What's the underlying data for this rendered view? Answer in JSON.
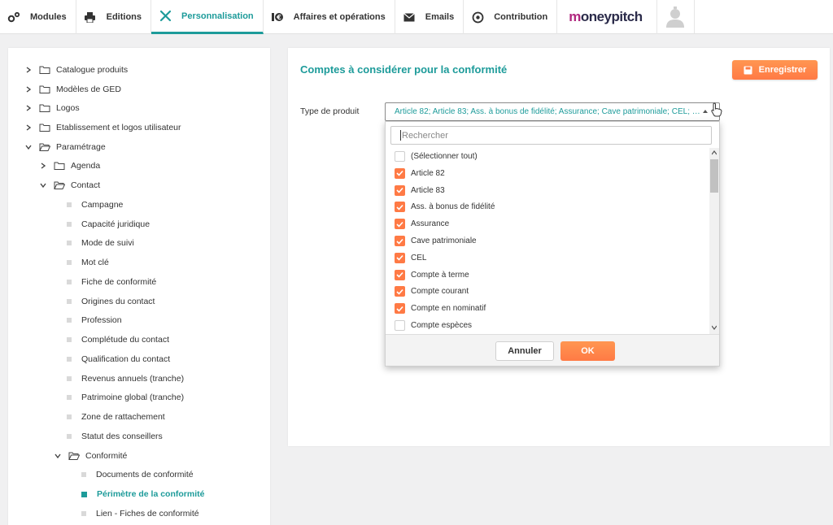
{
  "nav": {
    "tabs": [
      {
        "label": "Modules",
        "icon": "gears-icon"
      },
      {
        "label": "Editions",
        "icon": "printer-icon"
      },
      {
        "label": "Personnalisation",
        "icon": "tools-icon",
        "active": true
      },
      {
        "label": "Affaires et opérations",
        "icon": "money-icon"
      },
      {
        "label": "Emails",
        "icon": "envelope-icon"
      },
      {
        "label": "Contribution",
        "icon": "contribution-icon"
      }
    ],
    "brand": "moneypitch",
    "avatar_icon": "user-avatar-icon"
  },
  "tree": {
    "items": [
      {
        "label": "Catalogue produits",
        "type": "folder",
        "expanded": false
      },
      {
        "label": "Modèles de GED",
        "type": "folder",
        "expanded": false
      },
      {
        "label": "Logos",
        "type": "folder",
        "expanded": false
      },
      {
        "label": "Etablissement et logos utilisateur",
        "type": "folder",
        "expanded": false
      },
      {
        "label": "Paramétrage",
        "type": "folder",
        "expanded": true
      },
      {
        "label": "Agenda",
        "type": "folder",
        "expanded": false
      },
      {
        "label": "Contact",
        "type": "folder",
        "expanded": true
      },
      {
        "label": "Campagne",
        "type": "leaf"
      },
      {
        "label": "Capacité juridique",
        "type": "leaf"
      },
      {
        "label": "Mode de suivi",
        "type": "leaf"
      },
      {
        "label": "Mot clé",
        "type": "leaf"
      },
      {
        "label": "Fiche de conformité",
        "type": "leaf"
      },
      {
        "label": "Origines du contact",
        "type": "leaf"
      },
      {
        "label": "Profession",
        "type": "leaf"
      },
      {
        "label": "Complétude du contact",
        "type": "leaf"
      },
      {
        "label": "Qualification du contact",
        "type": "leaf"
      },
      {
        "label": "Revenus annuels (tranche)",
        "type": "leaf"
      },
      {
        "label": "Patrimoine global (tranche)",
        "type": "leaf"
      },
      {
        "label": "Zone de rattachement",
        "type": "leaf"
      },
      {
        "label": "Statut des conseillers",
        "type": "leaf"
      },
      {
        "label": "Conformité",
        "type": "folder",
        "expanded": true
      },
      {
        "label": "Documents de conformité",
        "type": "leaf"
      },
      {
        "label": "Périmètre de la conformité",
        "type": "leaf",
        "selected": true
      },
      {
        "label": "Lien - Fiches de conformité",
        "type": "leaf"
      }
    ]
  },
  "main": {
    "title": "Comptes à considérer pour la conformité",
    "save_label": "Enregistrer",
    "field_label": "Type de produit",
    "field_value": "Article 82; Article 83; Ass. à bonus de fidélité; Assurance; Cave patrimoniale; CEL; Compte à terme; Compte courant; Compte en nominatif"
  },
  "dropdown": {
    "search_placeholder": "Rechercher",
    "options": [
      {
        "label": "(Sélectionner tout)",
        "checked": false
      },
      {
        "label": "Article 82",
        "checked": true
      },
      {
        "label": "Article 83",
        "checked": true
      },
      {
        "label": "Ass. à bonus de fidélité",
        "checked": true
      },
      {
        "label": "Assurance",
        "checked": true
      },
      {
        "label": "Cave patrimoniale",
        "checked": true
      },
      {
        "label": "CEL",
        "checked": true
      },
      {
        "label": "Compte à terme",
        "checked": true
      },
      {
        "label": "Compte courant",
        "checked": true
      },
      {
        "label": "Compte en nominatif",
        "checked": true
      },
      {
        "label": "Compte espèces",
        "checked": false
      }
    ],
    "cancel_label": "Annuler",
    "ok_label": "OK"
  },
  "colors": {
    "accent": "#1d9b9a",
    "action": "#ff7a45"
  }
}
